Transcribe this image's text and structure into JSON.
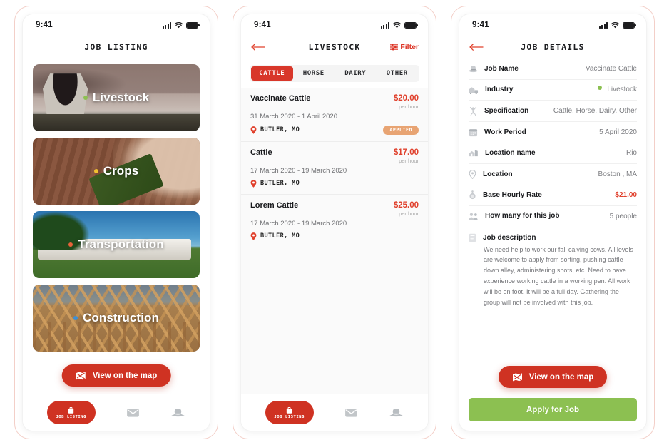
{
  "theme": {
    "accent_red": "#cf3222",
    "accent_green": "#8cc051",
    "badge_orange": "#e8a473",
    "frame_border": "#f3cfc8"
  },
  "status_bar": {
    "time": "9:41"
  },
  "screen1": {
    "title": "JOB LISTING",
    "categories": [
      {
        "label": "Livestock",
        "dot_color": "#8cc051"
      },
      {
        "label": "Crops",
        "dot_color": "#f2c130"
      },
      {
        "label": "Transportation",
        "dot_color": "#e8623a"
      },
      {
        "label": "Construction",
        "dot_color": "#3d8fd6"
      }
    ],
    "map_button": "View on the map",
    "tabs": [
      {
        "label": "JOB LISTING",
        "icon": "briefcase-icon",
        "active": true
      },
      {
        "label": "",
        "icon": "mail-icon",
        "active": false
      },
      {
        "label": "",
        "icon": "hat-icon",
        "active": false
      }
    ]
  },
  "screen2": {
    "title": "LIVESTOCK",
    "filter_label": "Filter",
    "segments": [
      {
        "label": "CATTLE",
        "active": true
      },
      {
        "label": "HORSE",
        "active": false
      },
      {
        "label": "DAIRY",
        "active": false
      },
      {
        "label": "OTHER",
        "active": false
      }
    ],
    "jobs": [
      {
        "title": "Vaccinate Cattle",
        "dates": "31 March 2020 - 1 April 2020",
        "location": "BUTLER, MO",
        "price": "$20.00",
        "rate_unit": "per hour",
        "badge": "APPLIED"
      },
      {
        "title": "Cattle",
        "dates": "17 March 2020 - 19 March 2020",
        "location": "BUTLER, MO",
        "price": "$17.00",
        "rate_unit": "per hour",
        "badge": ""
      },
      {
        "title": "Lorem Cattle",
        "dates": "17 March 2020 - 19 March 2020",
        "location": "BUTLER, MO",
        "price": "$25.00",
        "rate_unit": "per hour",
        "badge": ""
      }
    ],
    "tabs": [
      {
        "label": "JOB LISTING",
        "icon": "briefcase-icon",
        "active": true
      },
      {
        "label": "",
        "icon": "mail-icon",
        "active": false
      },
      {
        "label": "",
        "icon": "hat-icon",
        "active": false
      }
    ]
  },
  "screen3": {
    "title": "JOB DETAILS",
    "rows": [
      {
        "label": "Job Name",
        "value": "Vaccinate Cattle",
        "icon": "hat-icon"
      },
      {
        "label": "Industry",
        "value": "Livestock",
        "icon": "barn-icon",
        "dot_color": "#8cc051"
      },
      {
        "label": "Specification",
        "value": "Cattle, Horse, Dairy, Other",
        "icon": "cow-icon"
      },
      {
        "label": "Work Period",
        "value": "5 April 2020",
        "icon": "calendar-icon"
      },
      {
        "label": "Location name",
        "value": "Rio",
        "icon": "farm-icon"
      },
      {
        "label": "Location",
        "value": "Boston , MA",
        "icon": "pin-icon"
      },
      {
        "label": "Base Hourly Rate",
        "value": "$21.00",
        "icon": "coin-icon",
        "is_price": true
      },
      {
        "label": "How many for this job",
        "value": "5 people",
        "icon": "people-icon"
      }
    ],
    "description_label": "Job description",
    "description_icon": "document-icon",
    "description": "We need help to work our fall calving cows. All levels are welcome to apply from sorting, pushing cattle down alley, administering shots, etc. Need to have experience working cattle in a working pen. All work will be on foot. It will be a full day. Gathering the group will not be involved with this job.",
    "map_button": "View on the map",
    "apply_button": "Apply for Job"
  }
}
